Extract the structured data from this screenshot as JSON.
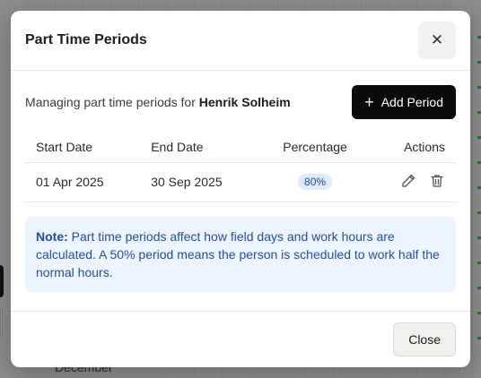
{
  "background": {
    "month_label": "December"
  },
  "dialog": {
    "title": "Part Time Periods",
    "close_icon": "close-icon"
  },
  "subheader": {
    "prefix": "Managing part time periods for",
    "person": "Henrik Solheim",
    "add_button_label": "Add Period",
    "add_button_icon": "plus-icon"
  },
  "table": {
    "columns": [
      "Start Date",
      "End Date",
      "Percentage",
      "Actions"
    ],
    "rows": [
      {
        "start_date": "01 Apr 2025",
        "end_date": "30 Sep 2025",
        "percentage": "80%",
        "actions": [
          "pencil-icon",
          "trash-icon"
        ]
      }
    ]
  },
  "note": {
    "label": "Note:",
    "text": "Part time periods affect how field days and work hours are calculated. A 50% period means the person is scheduled to work half the normal hours."
  },
  "footer": {
    "close_button_label": "Close"
  },
  "colors": {
    "primary_button": "#0b0b0b",
    "badge_bg": "#dfeafb",
    "badge_text": "#1e4fa0",
    "note_bg": "#eef4fd",
    "note_text": "#2251a0"
  }
}
